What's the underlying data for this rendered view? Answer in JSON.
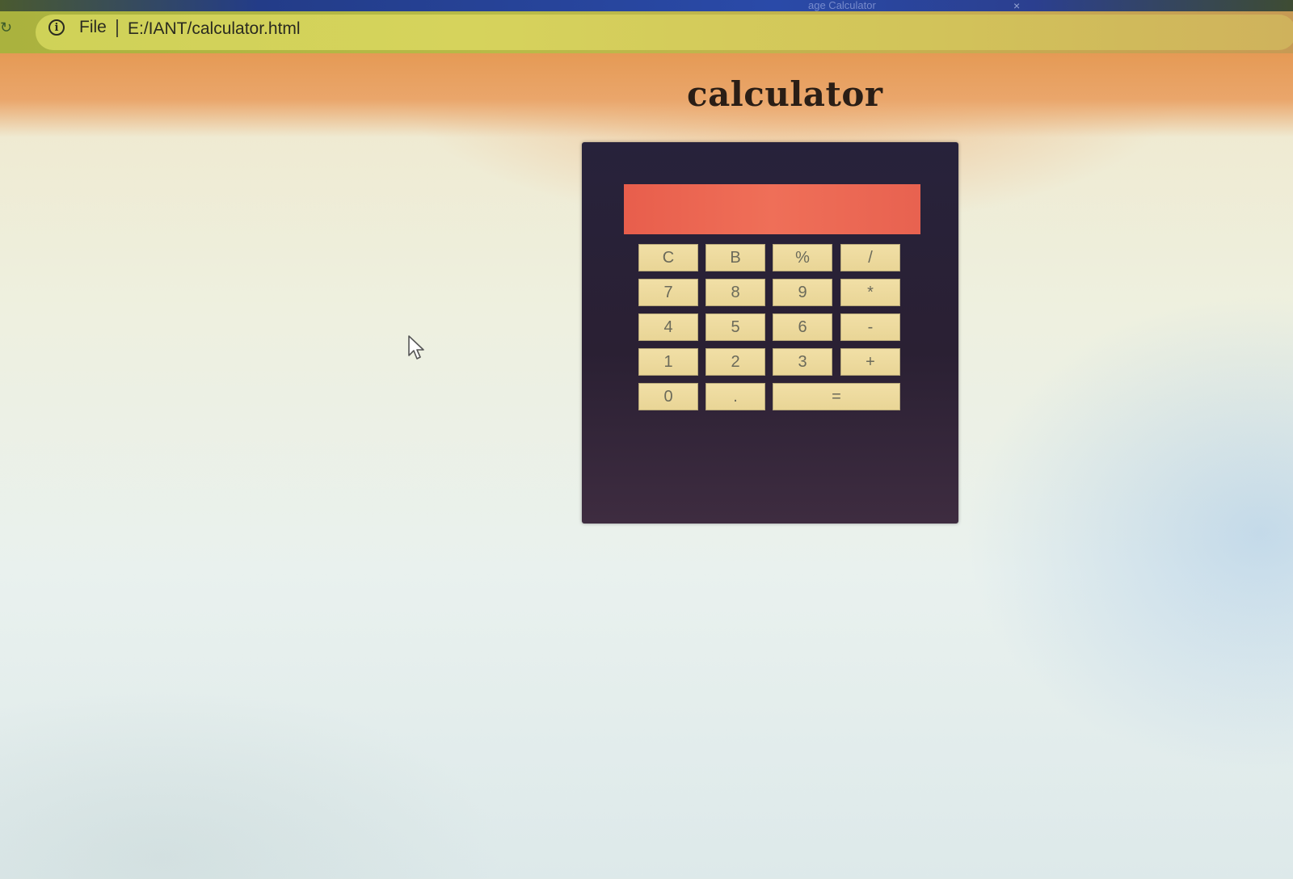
{
  "browser": {
    "tab_title": "age Calculator",
    "tab_close": "×",
    "scheme_label": "File",
    "url": "E:/IANT/calculator.html",
    "reload_glyph": "↻",
    "info_glyph": "i"
  },
  "page": {
    "title": "calculator"
  },
  "calculator": {
    "display_value": "",
    "rows": [
      [
        "C",
        "B",
        "%",
        "/"
      ],
      [
        "7",
        "8",
        "9",
        "*"
      ],
      [
        "4",
        "5",
        "6",
        "-"
      ],
      [
        "1",
        "2",
        "3",
        "+"
      ],
      [
        "0",
        ".",
        "="
      ]
    ]
  },
  "colors": {
    "calculator_body": "#27223b",
    "display": "#ef6f58",
    "key": "#f1dfa6",
    "header_band": "#e59a55"
  }
}
